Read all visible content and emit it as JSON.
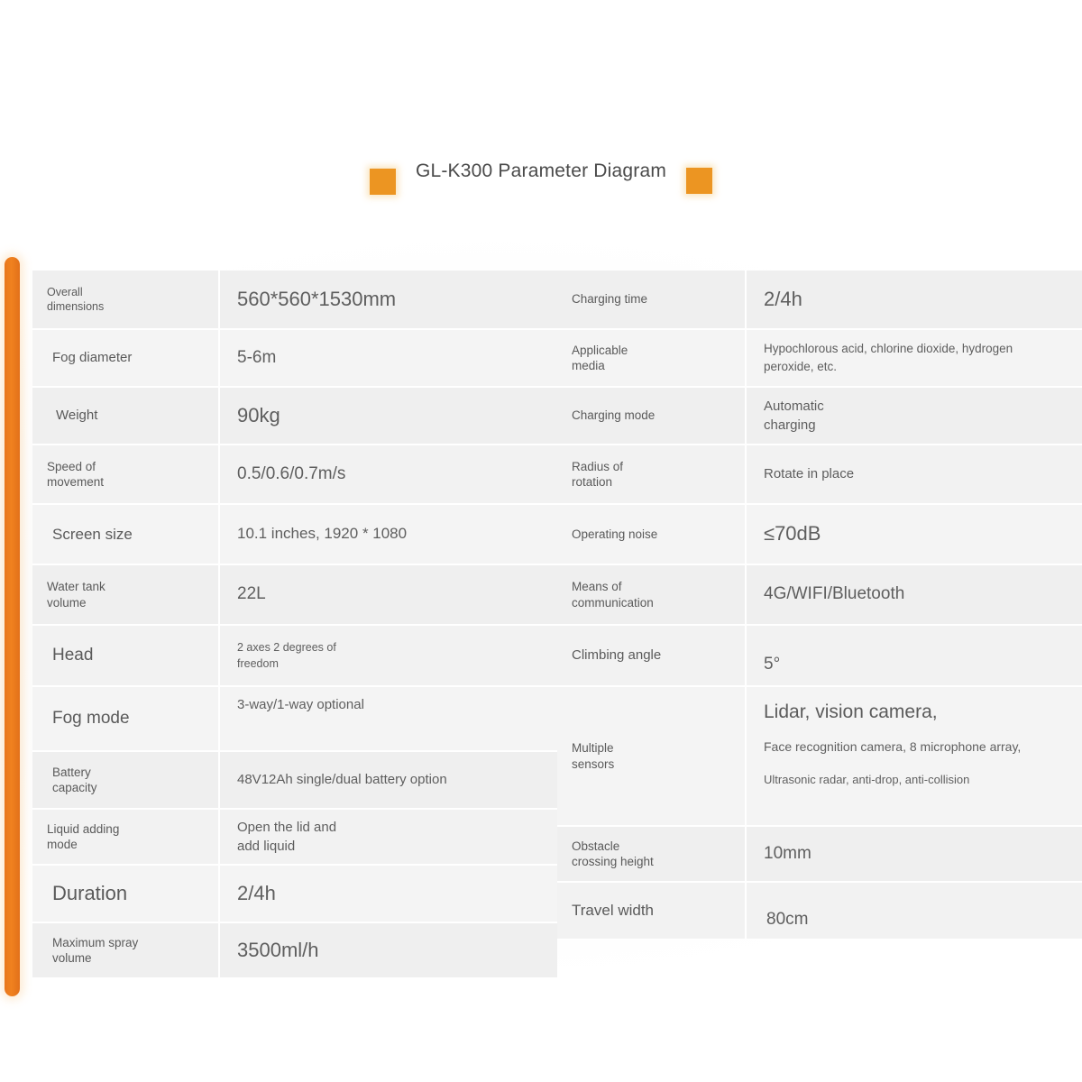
{
  "title": {
    "text": "GL-K300 Parameter Diagram",
    "marker_color": "#ec9522",
    "accent_bar_color": "#ee7c1e"
  },
  "spec_table": {
    "left_column": [
      {
        "label": "Overall\ndimensions",
        "label_lines": [
          "Overall",
          "dimensions"
        ],
        "value": "560*560*1530mm"
      },
      {
        "label": "Fog diameter",
        "label_lines": [
          "Fog diameter"
        ],
        "value": "5-6m"
      },
      {
        "label": "Weight",
        "label_lines": [
          "Weight"
        ],
        "value": "90kg"
      },
      {
        "label": "Speed of movement",
        "label_lines": [
          "Speed of",
          "movement"
        ],
        "value": "0.5/0.6/0.7m/s"
      },
      {
        "label": "Screen size",
        "label_lines": [
          "Screen size"
        ],
        "value": "10.1 inches, 1920 * 1080"
      },
      {
        "label": "Water tank volume",
        "label_lines": [
          "Water tank",
          "volume"
        ],
        "value": "22L"
      },
      {
        "label": "Head",
        "label_lines": [
          "Head"
        ],
        "value": "2 axes 2 degrees of freedom",
        "value_lines": [
          "2 axes 2 degrees of",
          "freedom"
        ]
      },
      {
        "label": "Fog mode",
        "label_lines": [
          "Fog mode"
        ],
        "value": "3-way/1-way optional"
      },
      {
        "label": "Battery capacity",
        "label_lines": [
          "Battery",
          "capacity"
        ],
        "value": "48V12Ah single/dual battery option"
      },
      {
        "label": "Liquid adding mode",
        "label_lines": [
          "Liquid adding",
          "mode"
        ],
        "value": "Open the lid and add liquid",
        "value_lines": [
          "Open the lid and",
          "add liquid"
        ]
      },
      {
        "label": "Duration",
        "label_lines": [
          "Duration"
        ],
        "value": "2/4h"
      },
      {
        "label": "Maximum spray volume",
        "label_lines": [
          "Maximum spray",
          "volume"
        ],
        "value": "3500ml/h"
      }
    ],
    "right_column": [
      {
        "label": "Charging time",
        "label_lines": [
          "Charging time"
        ],
        "value": "2/4h"
      },
      {
        "label": "Applicable media",
        "label_lines": [
          "Applicable",
          "media"
        ],
        "value": "Hypochlorous acid, chlorine dioxide, hydrogen peroxide, etc.",
        "value_lines": [
          "Hypochlorous acid, chlorine dioxide, hydrogen",
          "peroxide, etc."
        ]
      },
      {
        "label": "Charging mode",
        "label_lines": [
          "Charging mode"
        ],
        "value": "Automatic charging",
        "value_lines": [
          "Automatic",
          "charging"
        ]
      },
      {
        "label": "Radius of rotation",
        "label_lines": [
          "Radius of",
          "rotation"
        ],
        "value": "Rotate in place"
      },
      {
        "label": "Operating noise",
        "label_lines": [
          "Operating noise"
        ],
        "value": "≤70dB"
      },
      {
        "label": "Means of communication",
        "label_lines": [
          "Means of",
          "communication"
        ],
        "value": "4G/WIFI/Bluetooth"
      },
      {
        "label": "Climbing angle",
        "label_lines": [
          "Climbing angle"
        ],
        "value": "5°"
      },
      {
        "label": "Multiple sensors",
        "label_lines": [
          "Multiple",
          "sensors"
        ],
        "value": "Lidar, vision camera, Face recognition camera, 8 microphone array, Ultrasonic radar, anti-drop, anti-collision",
        "value_lines": [
          "Lidar, vision camera,",
          "Face recognition camera, 8 microphone array,",
          "Ultrasonic radar, anti-drop, anti-collision"
        ]
      },
      {
        "label": "Obstacle crossing height",
        "label_lines": [
          "Obstacle",
          "crossing height"
        ],
        "value": "10mm"
      },
      {
        "label": "Travel width",
        "label_lines": [
          "Travel width"
        ],
        "value": "80cm"
      }
    ]
  }
}
